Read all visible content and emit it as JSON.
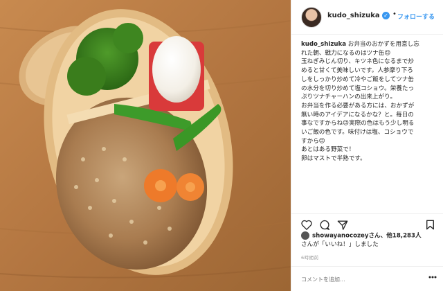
{
  "post": {
    "username": "kudo_shizuka",
    "follow_label": "フォローする",
    "separator": "•",
    "caption_user": "kudo_shizuka",
    "caption_first": " お弁当のおかずを用意し忘",
    "caption_lines": [
      "れた朝、戦力になるのはツナ缶😉",
      "玉ねぎみじん切り、キツネ色になるまで炒",
      "めると甘くて美味しいです。人参摩り下ろ",
      "しをしっかり炒めて冷やご飯をしてツナ缶",
      "の水分を切り炒めて塩コショウ。栄養たっ",
      "ぷりツナチャーハンの出来上がり。",
      "お弁当を作る必要がある方には、おかずが",
      "無い時のアイデアになるかな？と。毎日の",
      "事なですからね😉実際の色はもう少し明る",
      "いご飯の色です。味付けは塩、コショウで",
      "すから😉",
      "あとはある野菜で！",
      "卵はマストで半熟です。"
    ],
    "likes_first_line": "showayanocozeyさん、他18,283人",
    "likes_second_line": "さんが「いいね！」しました",
    "time_ago": "6時間前",
    "comment_placeholder": "コメントを追加...",
    "colors": {
      "link": "#3897f0",
      "text": "#262626",
      "muted": "#999999"
    }
  }
}
